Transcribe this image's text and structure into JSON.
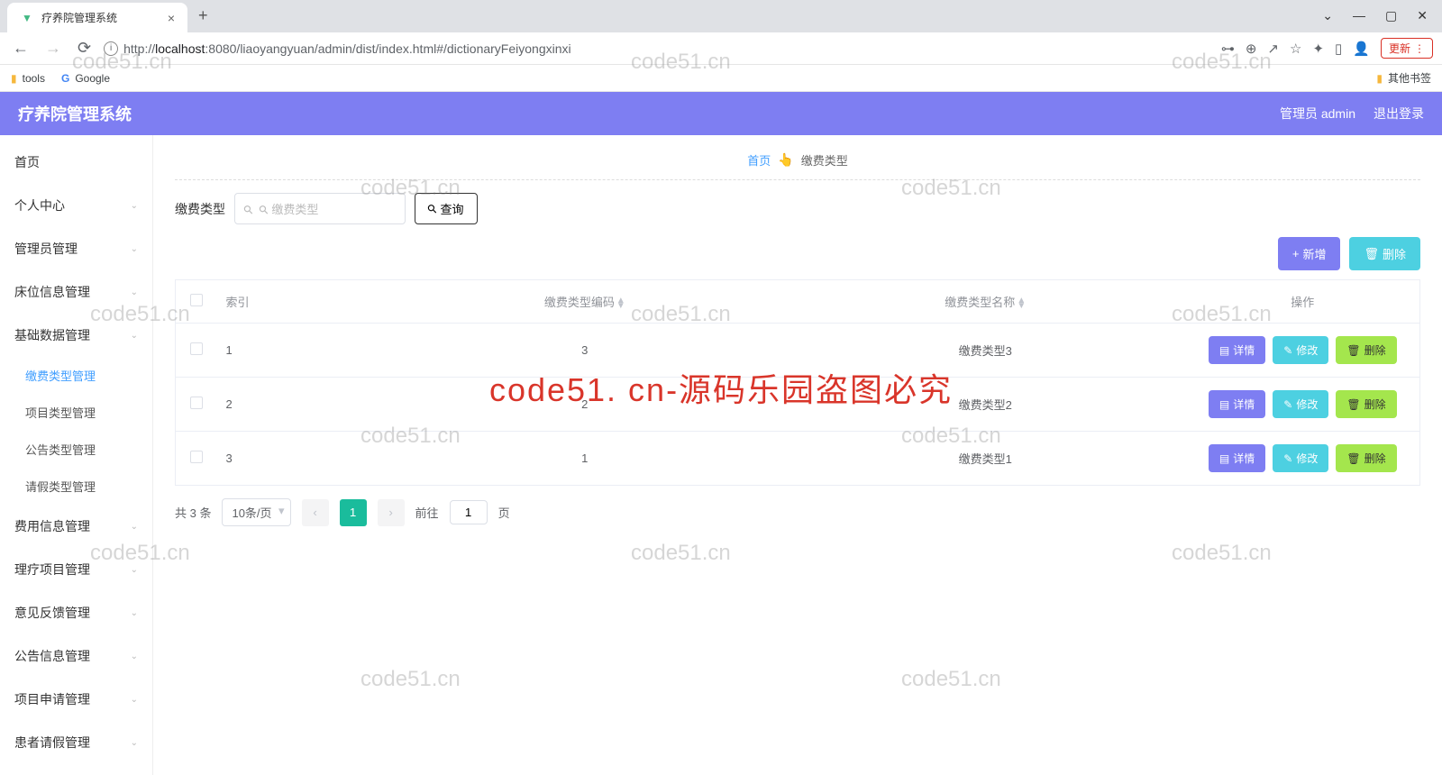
{
  "browser": {
    "tab_title": "疗养院管理系统",
    "url_prefix": "http://",
    "url_host": "localhost",
    "url_path": ":8080/liaoyangyuan/admin/dist/index.html#/dictionaryFeiyongxinxi",
    "update_label": "更新",
    "bookmarks": {
      "tools": "tools",
      "google": "Google",
      "other": "其他书签"
    },
    "win": {
      "min": "—",
      "max": "▢",
      "close": "✕",
      "dropdown": "⌄"
    }
  },
  "header": {
    "title": "疗养院管理系统",
    "user": "管理员 admin",
    "logout": "退出登录"
  },
  "sidebar": {
    "items": [
      {
        "label": "首页",
        "has_sub": false
      },
      {
        "label": "个人中心",
        "has_sub": true
      },
      {
        "label": "管理员管理",
        "has_sub": true
      },
      {
        "label": "床位信息管理",
        "has_sub": true
      },
      {
        "label": "基础数据管理",
        "has_sub": true,
        "open": true,
        "children": [
          {
            "label": "缴费类型管理",
            "active": true
          },
          {
            "label": "项目类型管理"
          },
          {
            "label": "公告类型管理"
          },
          {
            "label": "请假类型管理"
          }
        ]
      },
      {
        "label": "费用信息管理",
        "has_sub": true
      },
      {
        "label": "理疗项目管理",
        "has_sub": true
      },
      {
        "label": "意见反馈管理",
        "has_sub": true
      },
      {
        "label": "公告信息管理",
        "has_sub": true
      },
      {
        "label": "项目申请管理",
        "has_sub": true
      },
      {
        "label": "患者请假管理",
        "has_sub": true
      }
    ]
  },
  "breadcrumb": {
    "home": "首页",
    "current": "缴费类型"
  },
  "search": {
    "label": "缴费类型",
    "placeholder": "缴费类型",
    "query_btn": "查询"
  },
  "actions": {
    "add": "新增",
    "delete": "删除"
  },
  "table": {
    "headers": {
      "index": "索引",
      "code": "缴费类型编码",
      "name": "缴费类型名称",
      "ops": "操作"
    },
    "rows": [
      {
        "idx": "1",
        "code": "3",
        "name": "缴费类型3"
      },
      {
        "idx": "2",
        "code": "2",
        "name": "缴费类型2"
      },
      {
        "idx": "3",
        "code": "1",
        "name": "缴费类型1"
      }
    ],
    "ops": {
      "detail": "详情",
      "edit": "修改",
      "delete": "删除"
    }
  },
  "pagination": {
    "total": "共 3 条",
    "per_page": "10条/页",
    "current": "1",
    "goto_prefix": "前往",
    "goto_value": "1",
    "goto_suffix": "页"
  },
  "watermark": {
    "text": "code51.cn",
    "red": "code51. cn-源码乐园盗图必究"
  }
}
